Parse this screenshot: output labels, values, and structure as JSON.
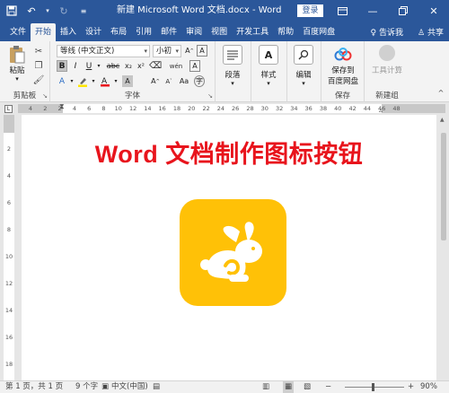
{
  "title_bar": {
    "doc_title": "新建 Microsoft Word 文档.docx  -  Word",
    "login_label": "登录",
    "save_icon": "save-icon",
    "undo_icon": "undo-icon",
    "redo_icon": "redo-icon",
    "customize_icon": "customize-qat-icon",
    "ribbon_display_icon": "ribbon-display-icon",
    "minimize_icon": "minimize-icon",
    "restore_icon": "restore-icon",
    "close_icon": "close-icon"
  },
  "tabs": [
    "文件",
    "开始",
    "插入",
    "设计",
    "布局",
    "引用",
    "邮件",
    "审阅",
    "视图",
    "开发工具",
    "帮助",
    "百度网盘"
  ],
  "active_tab": "开始",
  "tell_me": "告诉我",
  "share": "共享",
  "ribbon": {
    "clipboard": {
      "paste_label": "粘贴",
      "group_label": "剪贴板"
    },
    "font": {
      "font_name": "等线 (中文正文)",
      "font_size": "小初",
      "group_label": "字体",
      "row2": [
        "B",
        "I",
        "U",
        "abc",
        "x₂",
        "x²"
      ],
      "wen_label": "wén",
      "font_color": "#e8141c",
      "highlight_color": "#ffe600"
    },
    "paragraph": {
      "label": "段落"
    },
    "styles": {
      "label": "样式"
    },
    "editing": {
      "label": "编辑"
    },
    "save": {
      "label_line1": "保存到",
      "label_line2": "百度网盘",
      "group_label": "保存"
    },
    "new_group": {
      "tool_label": "工具计算",
      "group_label": "新建组"
    }
  },
  "ruler": {
    "h_ticks": [
      "4",
      "2",
      "2",
      "4",
      "6",
      "8",
      "10",
      "12",
      "14",
      "16",
      "18",
      "20",
      "22",
      "24",
      "26",
      "28",
      "30",
      "32",
      "34",
      "36",
      "38",
      "40",
      "42",
      "44",
      "46",
      "48"
    ],
    "v_ticks": [
      "2",
      "4",
      "6",
      "8",
      "10",
      "12",
      "14",
      "16",
      "18"
    ]
  },
  "document": {
    "heading": "Word 文档制作图标按钮",
    "icon_bg_color": "#ffc107",
    "icon_name": "rabbit-icon"
  },
  "status_bar": {
    "page": "第 1 页，共 1 页",
    "words": "9 个字",
    "language": "中文(中国)",
    "zoom": "90%"
  }
}
